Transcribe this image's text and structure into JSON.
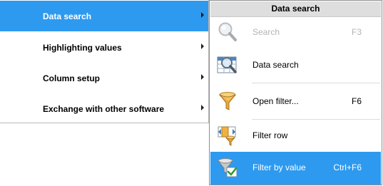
{
  "main_menu": {
    "items": [
      {
        "label": "Data search"
      },
      {
        "label": "Highlighting values"
      },
      {
        "label": "Column setup"
      },
      {
        "label": "Exchange with other software"
      }
    ]
  },
  "submenu": {
    "title": "Data search",
    "items": [
      {
        "label": "Search",
        "shortcut": "F3",
        "icon": "magnifier-icon",
        "state": "disabled"
      },
      {
        "label": "Data search",
        "shortcut": "",
        "icon": "table-search-icon",
        "state": "normal"
      },
      {
        "label": "Open filter...",
        "shortcut": "F6",
        "icon": "funnel-icon",
        "state": "normal"
      },
      {
        "label": "Filter row",
        "shortcut": "",
        "icon": "filter-row-icon",
        "state": "normal"
      },
      {
        "label": "Filter by value",
        "shortcut": "Ctrl+F6",
        "icon": "filter-check-icon",
        "state": "highlighted"
      }
    ]
  },
  "colors": {
    "highlight": "#2d9af0",
    "title_bar": "#dedede",
    "disabled_text": "#b4b4b4"
  }
}
